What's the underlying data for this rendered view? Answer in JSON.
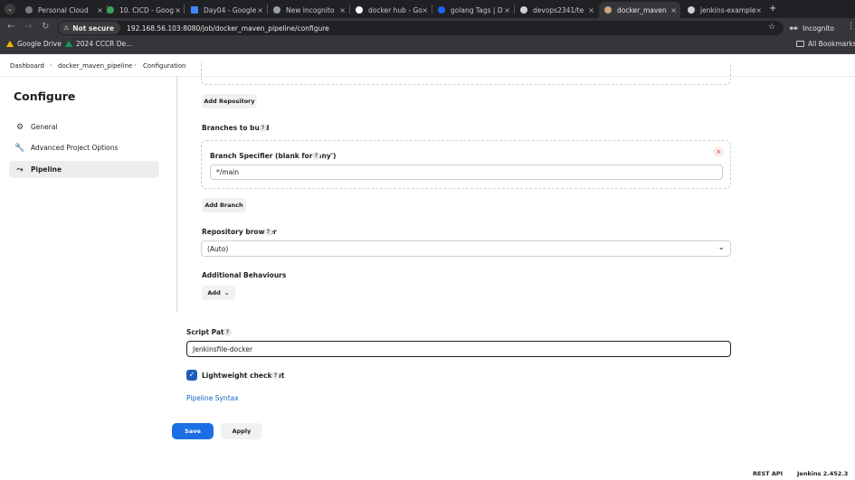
{
  "browser": {
    "tabs": [
      {
        "label": "Personal Cloud",
        "fav": "#7b7b7b"
      },
      {
        "label": "10. CICD - Goog",
        "fav": "#3ba15b"
      },
      {
        "label": "Day04 - Google",
        "fav": "#4285f4"
      },
      {
        "label": "New Incognito",
        "fav": "#9aa0a6"
      },
      {
        "label": "docker hub - Go",
        "fav": "#ffffff"
      },
      {
        "label": "golang Tags | D",
        "fav": "#1d63ed"
      },
      {
        "label": "devops2341/te",
        "fav": "#d0d0d0"
      },
      {
        "label": "docker_maven",
        "fav": "#c9a27e"
      },
      {
        "label": "jenkins-example",
        "fav": "#d0d0d0"
      }
    ],
    "security_label": "Not secure",
    "url": "192.168.56.103:8080/job/docker_maven_pipeline/configure",
    "profile_label": "Incognito",
    "bookmarks": [
      "Google Drive",
      "2024 CCCR De..."
    ],
    "all_bookmarks_label": "All Bookmarks"
  },
  "breadcrumb": {
    "items": [
      "Dashboard",
      "docker_maven_pipeline",
      "Configuration"
    ]
  },
  "sidebar": {
    "title": "Configure",
    "items": [
      {
        "label": "General",
        "icon": "gear-icon"
      },
      {
        "label": "Advanced Project Options",
        "icon": "wrench-icon"
      },
      {
        "label": "Pipeline",
        "icon": "pipeline-icon"
      }
    ]
  },
  "form": {
    "add_repository_label": "Add Repository",
    "branches_label": "Branches to build",
    "branch_specifier_label": "Branch Specifier (blank for 'any')",
    "branch_specifier_value": "*/main",
    "add_branch_label": "Add Branch",
    "repo_browser_label": "Repository browser",
    "repo_browser_value": "(Auto)",
    "additional_behaviours_label": "Additional Behaviours",
    "add_label": "Add",
    "script_path_label": "Script Path",
    "script_path_value": "Jenkinsfile-docker",
    "lightweight_label": "Lightweight checkout",
    "lightweight_checked": true,
    "pipeline_syntax_label": "Pipeline Syntax",
    "help_glyph": "?"
  },
  "actions": {
    "save_label": "Save",
    "apply_label": "Apply"
  },
  "footer": {
    "rest_api_label": "REST API",
    "version_label": "Jenkins 2.452.3"
  },
  "colors": {
    "primary": "#1c6fe3",
    "link": "#1565c0",
    "chrome_dark": "#202124"
  }
}
